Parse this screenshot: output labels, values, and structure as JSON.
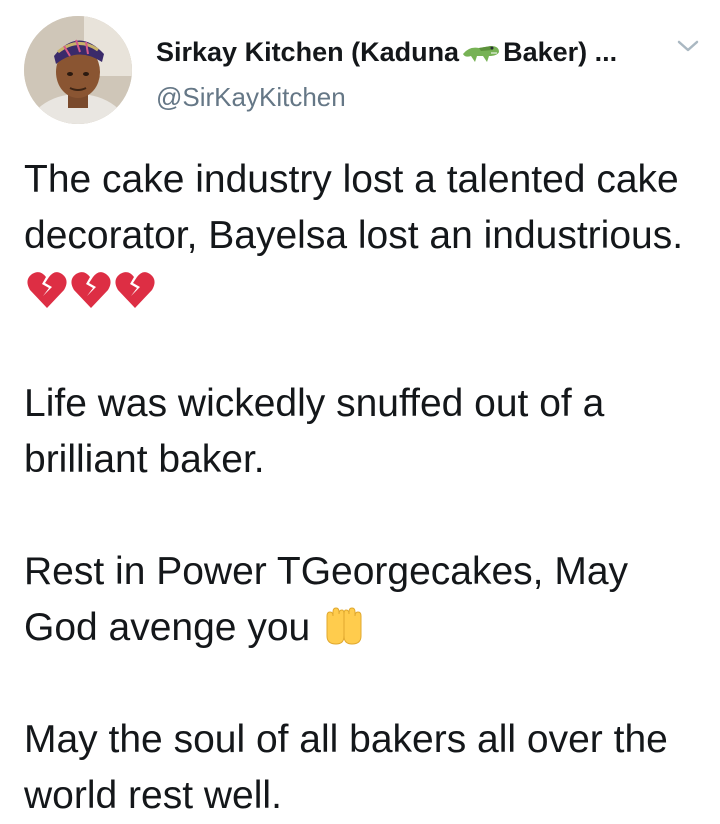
{
  "tweet": {
    "author": {
      "name_prefix": "Sirkay Kitchen (Kaduna",
      "name_emoji": "crocodile-emoji",
      "name_suffix": "Baker) ...",
      "handle": "@SirKayKitchen"
    },
    "menu_icon": "chevron-down-icon",
    "paragraphs": [
      {
        "text": "The cake industry lost a talented cake decorator, Bayelsa lost an industrious.",
        "emojis": [
          "broken-heart-emoji",
          "broken-heart-emoji",
          "broken-heart-emoji"
        ]
      },
      {
        "text": "Life was wickedly snuffed out of a brilliant baker."
      },
      {
        "text": "Rest in Power TGeorgecakes, May God avenge you",
        "emojis": [
          "raised-hands-emoji"
        ]
      },
      {
        "text": "May the soul of all bakers all over the world rest well."
      }
    ]
  },
  "colors": {
    "text": "#14171a",
    "secondary": "#657786",
    "broken_heart": "#dd2e44",
    "hands": "#ffcc4d"
  }
}
